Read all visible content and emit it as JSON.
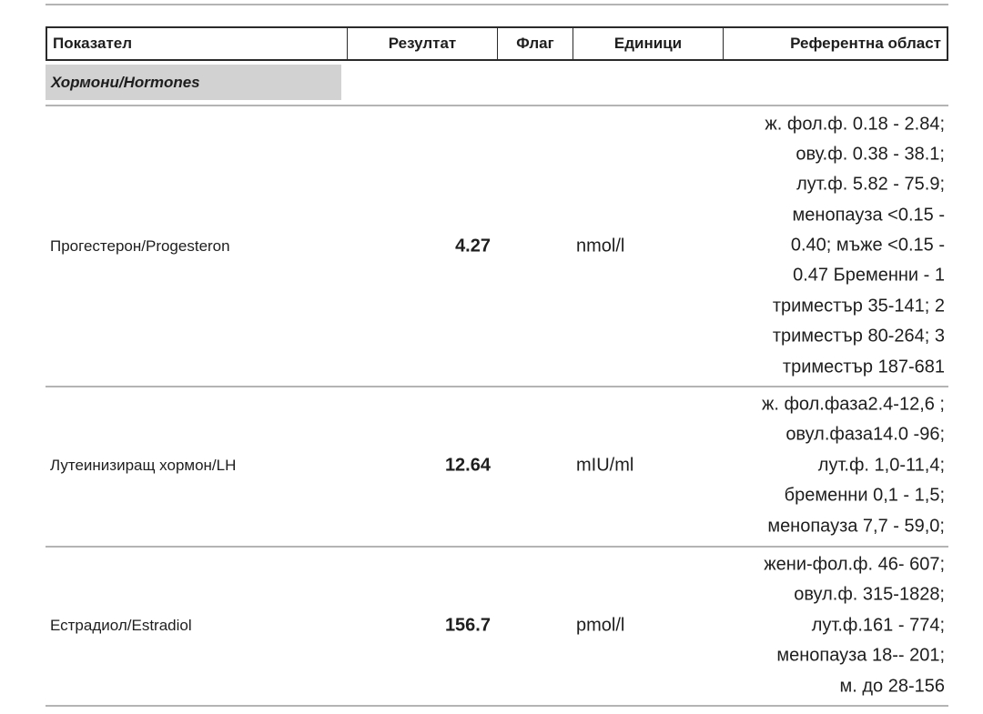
{
  "header": {
    "name": "Показател",
    "result": "Резултат",
    "flag": "Флаг",
    "units": "Единици",
    "reference": "Референтна област"
  },
  "section": {
    "title": "Хормони/Hormones"
  },
  "rows": [
    {
      "name": "Прогестерон/Progesteron",
      "result": "4.27",
      "flag": "",
      "unit": "nmol/l",
      "reference_lines": [
        "ж. фол.ф. 0.18 - 2.84;",
        "ову.ф. 0.38 - 38.1;",
        "лут.ф. 5.82 - 75.9;",
        "менопауза <0.15 -",
        "0.40; мъже <0.15 -",
        "0.47 Бременни - 1",
        "триместър 35-141; 2",
        "триместър 80-264; 3",
        "триместър 187-681"
      ]
    },
    {
      "name": "Лутеинизиращ хормон/LH",
      "result": "12.64",
      "flag": "",
      "unit": "mIU/ml",
      "reference_lines": [
        "ж. фол.фаза2.4-12,6 ;",
        "овул.фаза14.0 -96;",
        "лут.ф. 1,0-11,4;",
        "бременни 0,1 - 1,5;",
        "менопауза 7,7 - 59,0;"
      ]
    },
    {
      "name": "Естрадиол/Estradiol",
      "result": "156.7",
      "flag": "",
      "unit": "pmol/l",
      "reference_lines": [
        "жени-фол.ф. 46- 607;",
        "овул.ф. 315-1828;",
        "лут.ф.161 - 774;",
        "менопауза 18-- 201;",
        "м. до 28-156"
      ]
    }
  ]
}
